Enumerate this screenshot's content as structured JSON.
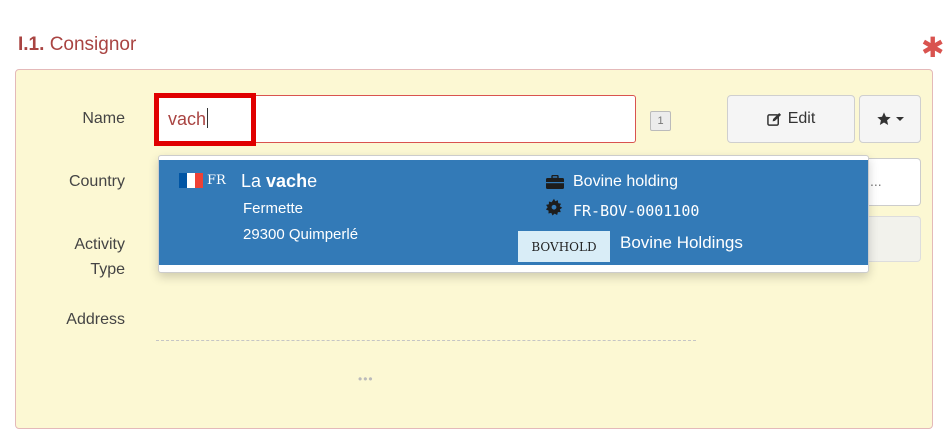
{
  "section": {
    "number": "I.1.",
    "title": "Consignor",
    "required_mark": "✱"
  },
  "form": {
    "name_label": "Name",
    "country_label": "Country",
    "activity_label_line1": "Activity",
    "activity_label_line2": "Type",
    "address_label": "Address",
    "name_value": "vach",
    "result_count": "1",
    "edit_label": "Edit",
    "country_select_text": "...",
    "address_more": "•••"
  },
  "suggestion": {
    "country_code": "FR",
    "name_prefix": "La ",
    "name_match": "vach",
    "name_suffix": "e",
    "address_line1": "Fermette",
    "address_line2": "29300 Quimperlé",
    "activity": "Bovine holding",
    "identifier": "FR-BOV-0001100",
    "org_code": "BOVHOLD",
    "org_name": "Bovine Holdings"
  },
  "colors": {
    "section_title": "#a94442",
    "required": "#d9534f",
    "panel_bg": "#fcf8d3",
    "suggestion_bg": "#337ab7",
    "highlight": "#e00000",
    "flag": [
      "#0055a4",
      "#ffffff",
      "#ef4135"
    ]
  },
  "icons": {
    "edit": "pencil-square-icon",
    "favorites": "star-icon",
    "flag": "flag-france-icon",
    "activity": "briefcase-icon",
    "identifier": "gear-icon"
  }
}
